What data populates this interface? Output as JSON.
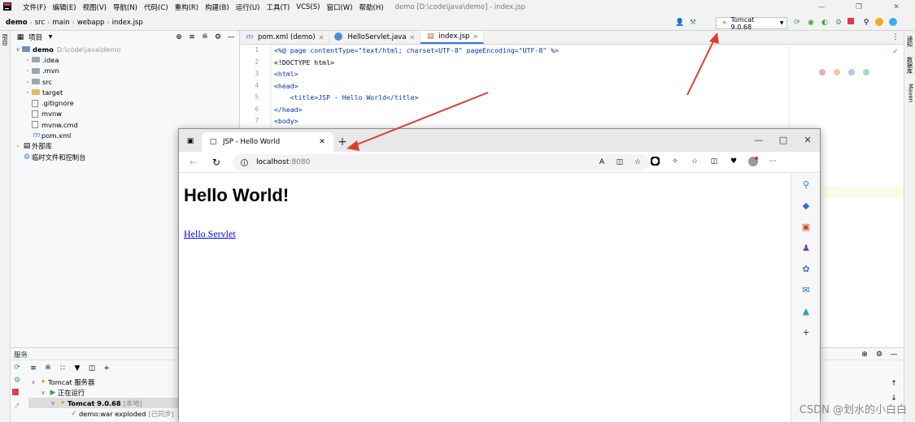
{
  "menubar": {
    "items": [
      "文件(F)",
      "编辑(E)",
      "视图(V)",
      "导航(N)",
      "代码(C)",
      "重构(R)",
      "构建(B)",
      "运行(U)",
      "工具(T)",
      "VCS(S)",
      "窗口(W)",
      "帮助(H)"
    ],
    "window_title": "demo [D:\\code\\java\\demo] - index.jsp"
  },
  "breadcrumb": [
    "demo",
    "src",
    "main",
    "webapp",
    "index.jsp"
  ],
  "run_config": "Tomcat 9.0.68",
  "left_toolwindow_label": "项目",
  "right_toolwindow_labels": [
    "通知",
    "数据库",
    "Maven"
  ],
  "project": {
    "header": "项目",
    "root_name": "demo",
    "root_path": "D:\\code\\java\\demo",
    "items": [
      ".idea",
      ".mvn",
      "src",
      "target",
      ".gitignore",
      "mvnw",
      "mvnw.cmd",
      "pom.xml"
    ],
    "external": "外部库",
    "scratches": "临时文件和控制台"
  },
  "editor": {
    "tabs": [
      "pom.xml (demo)",
      "HelloServlet.java",
      "index.jsp"
    ],
    "line_numbers": [
      "1",
      "2",
      "3",
      "4",
      "5",
      "6",
      "7"
    ],
    "lines": [
      "<%@ page contentType=\"text/html; charset=UTF-8\" pageEncoding=\"UTF-8\" %>",
      "<!DOCTYPE html>",
      "<html>",
      "<head>",
      "    <title>JSP - Hello World</title>",
      "</head>",
      "<body>"
    ]
  },
  "services": {
    "title": "服务",
    "tomcat_server": "Tomcat 服务器",
    "running": "正在运行",
    "instance": "Tomcat 9.0.68",
    "instance_tag": "[本地]",
    "artifact": "demo:war exploded",
    "artifact_tag": "[已同步]"
  },
  "browser": {
    "tab_title": "JSP - Hello World",
    "url": "localhost",
    "port": ":8080",
    "page_heading": "Hello World!",
    "page_link": "Hello Servlet"
  },
  "watermark": "CSDN @划水的小白白",
  "colors": {
    "accent": "#3574f0",
    "arrow": "#e03b2f",
    "link": "#0000ee"
  }
}
